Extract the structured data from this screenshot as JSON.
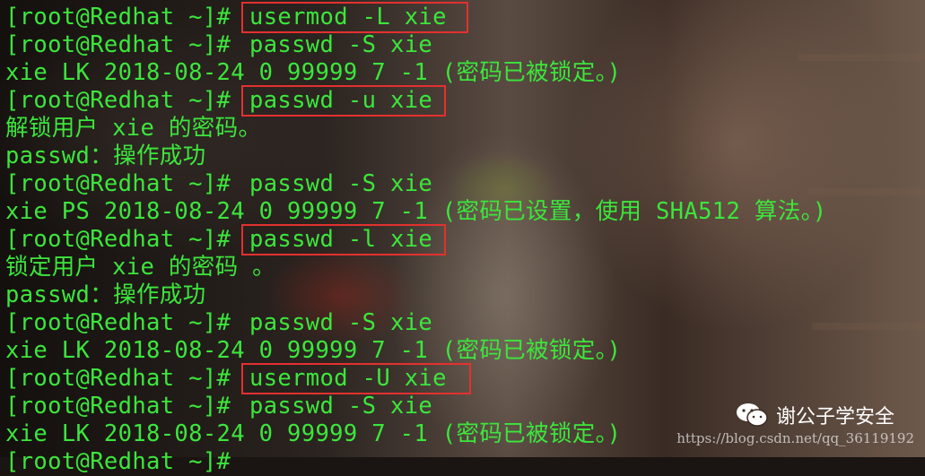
{
  "terminal": {
    "prompt": "[root@Redhat ~]#",
    "lines": [
      {
        "type": "prompt",
        "cmd": "usermod -L xie"
      },
      {
        "type": "prompt",
        "cmd": "passwd -S xie"
      },
      {
        "type": "output",
        "text": "xie LK 2018-08-24 0 99999 7 -1 (密码已被锁定。)"
      },
      {
        "type": "prompt",
        "cmd": "passwd -u xie"
      },
      {
        "type": "output",
        "text": "解锁用户 xie 的密码。"
      },
      {
        "type": "output",
        "text": "passwd：操作成功"
      },
      {
        "type": "prompt",
        "cmd": "passwd -S xie"
      },
      {
        "type": "output",
        "text": "xie PS 2018-08-24 0 99999 7 -1 (密码已设置，使用 SHA512 算法。)"
      },
      {
        "type": "prompt",
        "cmd": "passwd -l xie"
      },
      {
        "type": "output",
        "text": "锁定用户 xie 的密码 。"
      },
      {
        "type": "output",
        "text": "passwd：操作成功"
      },
      {
        "type": "prompt",
        "cmd": "passwd -S xie"
      },
      {
        "type": "output",
        "text": "xie LK 2018-08-24 0 99999 7 -1 (密码已被锁定。)"
      },
      {
        "type": "prompt",
        "cmd": "usermod -U xie"
      },
      {
        "type": "prompt",
        "cmd": "passwd -S xie"
      },
      {
        "type": "output",
        "text": "xie LK 2018-08-24 0 99999 7 -1 (密码已被锁定。)"
      }
    ]
  },
  "colors": {
    "text": "#3ce63c",
    "highlight": "#e3312f"
  },
  "watermark": {
    "icon": "wechat-icon",
    "label": "谢公子学安全",
    "url": "https://blog.csdn.net/qq_36119192"
  }
}
